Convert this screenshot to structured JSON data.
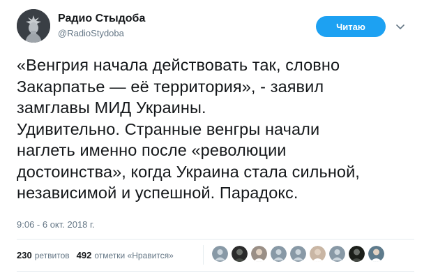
{
  "author": {
    "name": "Радио Стыдоба",
    "handle": "@RadioStydoba"
  },
  "follow_button": {
    "label": "Читаю"
  },
  "tweet": {
    "text": "«Венгрия начала действовать так, словно\nЗакарпатье — её территория», - заявил\nзамглавы МИД Украины.\nУдивительно. Странные венгры начали\nнаглеть именно после «революции\nдостоинства», когда Украина стала сильной,\nнезависимой и успешной. Парадокс.",
    "timestamp": "9:06 - 6 окт. 2018 г."
  },
  "stats": {
    "retweets_count": "230",
    "retweets_label": "ретвитов",
    "likes_count": "492",
    "likes_label": "отметки «Нравится»"
  },
  "likers": [
    {
      "icon": "default-avatar",
      "color": "#8899a6"
    },
    {
      "icon": "dark-avatar",
      "color": "#2b2b2b"
    },
    {
      "icon": "photo-avatar",
      "color": "#9a8f86"
    },
    {
      "icon": "default-avatar",
      "color": "#8899a6"
    },
    {
      "icon": "default-avatar",
      "color": "#8899a6"
    },
    {
      "icon": "person-photo-avatar",
      "color": "#c9b6a4"
    },
    {
      "icon": "default-avatar",
      "color": "#8899a6"
    },
    {
      "icon": "dark-photo-avatar",
      "color": "#1c1f1a"
    },
    {
      "icon": "bird-photo-avatar",
      "color": "#5e7b8c"
    }
  ],
  "colors": {
    "accent": "#1da1f2",
    "text": "#14171a",
    "muted": "#657786",
    "border": "#e6ecf0"
  }
}
